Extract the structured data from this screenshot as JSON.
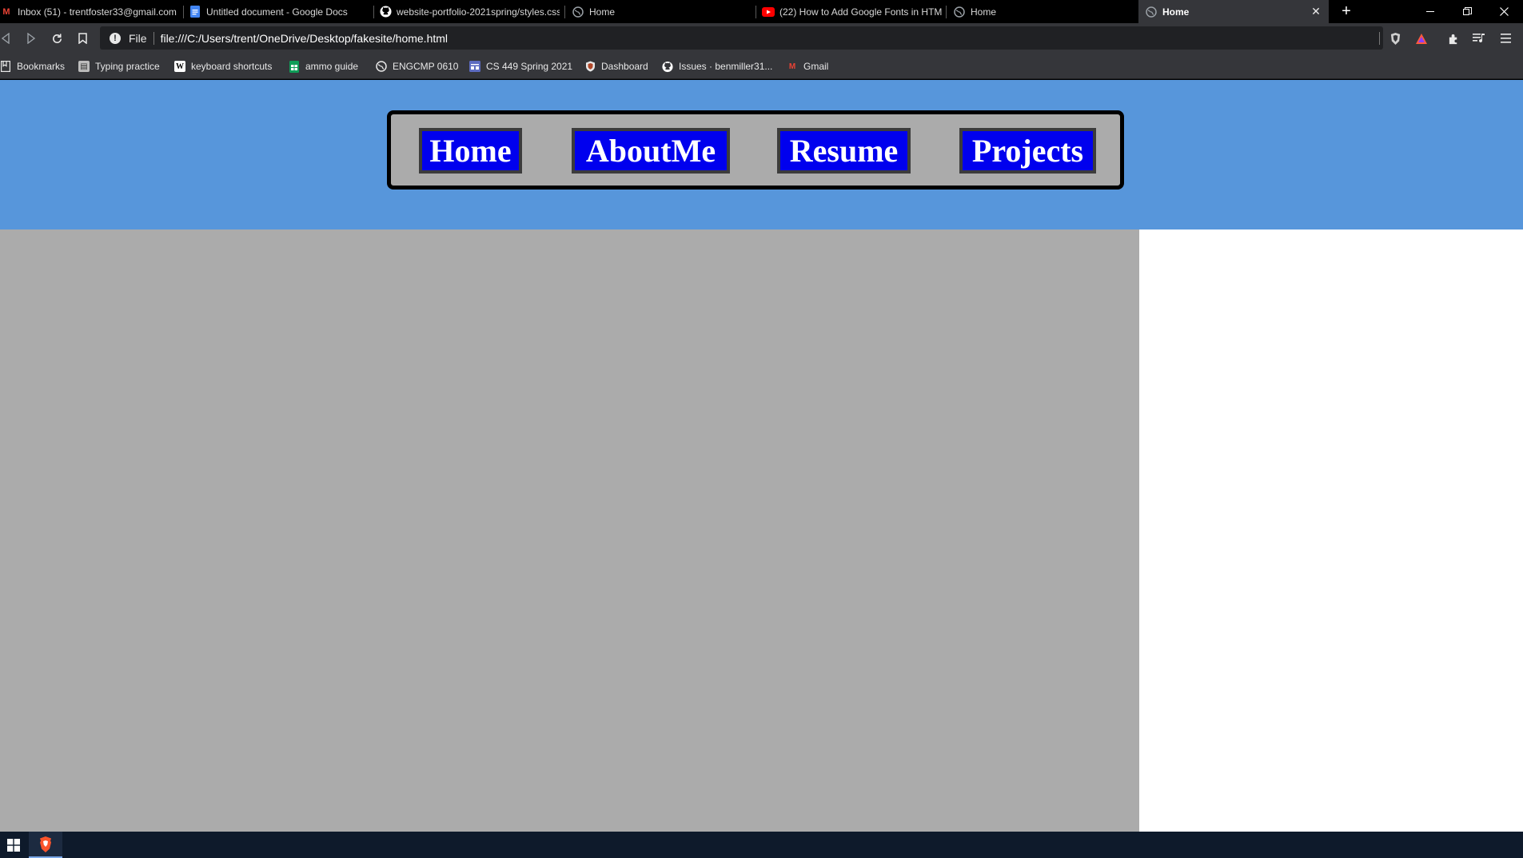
{
  "browser": {
    "tabs": [
      {
        "title": "Inbox (51) - trentfoster33@gmail.com",
        "icon": "gmail-icon",
        "active": false
      },
      {
        "title": "Untitled document - Google Docs",
        "icon": "google-docs-icon",
        "active": false
      },
      {
        "title": "website-portfolio-2021spring/styles.css",
        "icon": "github-icon",
        "active": false
      },
      {
        "title": "Home",
        "icon": "globe-icon",
        "active": false
      },
      {
        "title": "(22) How to Add Google Fonts in HTML",
        "icon": "youtube-icon",
        "active": false
      },
      {
        "title": "Home",
        "icon": "globe-icon",
        "active": false
      },
      {
        "title": "Home",
        "icon": "globe-icon",
        "active": true
      }
    ],
    "address_bar": {
      "scheme_label": "File",
      "url": "file:///C:/Users/trent/OneDrive/Desktop/fakesite/home.html"
    },
    "bookmarks": [
      {
        "label": "Bookmarks",
        "icon": "bookmarks-folder-icon"
      },
      {
        "label": "Typing practice",
        "icon": "typing-icon"
      },
      {
        "label": "keyboard shortcuts",
        "icon": "wikipedia-icon"
      },
      {
        "label": "ammo guide",
        "icon": "sheets-icon"
      },
      {
        "label": "ENGCMP 0610",
        "icon": "globe-icon"
      },
      {
        "label": "CS 449 Spring 2021",
        "icon": "calendar-icon"
      },
      {
        "label": "Dashboard",
        "icon": "shield-icon"
      },
      {
        "label": "Issues · benmiller31...",
        "icon": "github-icon"
      },
      {
        "label": "Gmail",
        "icon": "gmail-icon"
      }
    ]
  },
  "page": {
    "nav": [
      {
        "label": "Home"
      },
      {
        "label": "AboutMe"
      },
      {
        "label": "Resume"
      },
      {
        "label": "Projects"
      }
    ],
    "colors": {
      "header_bg": "#5796db",
      "nav_box_bg": "#ababab",
      "button_bg": "#0000ee",
      "content_bg": "#ababab"
    }
  }
}
